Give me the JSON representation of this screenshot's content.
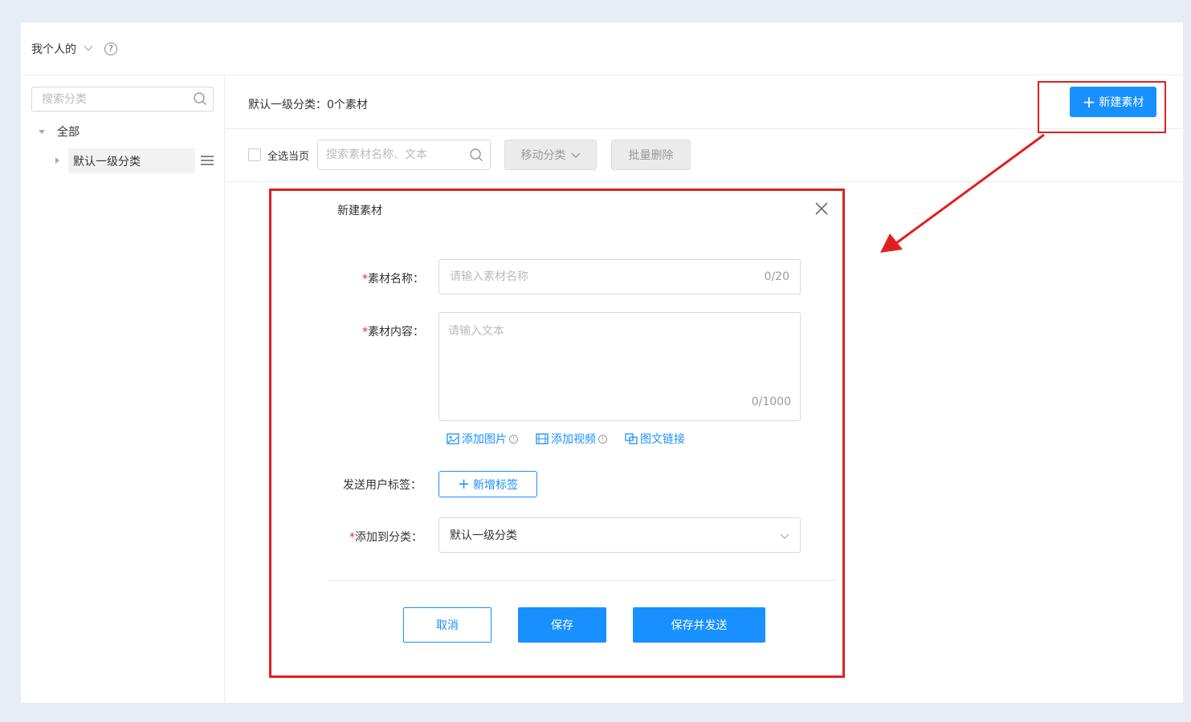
{
  "header": {
    "scope_label": "我个人的",
    "help_icon": "question-circle-icon",
    "help_glyph": "?"
  },
  "sidebar": {
    "search_placeholder": "搜索分类",
    "tree": {
      "root_label": "全部",
      "child_label": "默认一级分类"
    }
  },
  "main": {
    "breadcrumb": "默认一级分类：0个素材",
    "new_button_label": "新建素材",
    "toolbar": {
      "select_page_label": "全选当页",
      "search_placeholder": "搜索素材名称、文本",
      "move_label": "移动分类",
      "batch_delete_label": "批量删除"
    }
  },
  "modal": {
    "title": "新建素材",
    "required_mark": "*",
    "name": {
      "label": "素材名称：",
      "placeholder": "请输入素材名称",
      "counter": "0/20"
    },
    "content": {
      "label": "素材内容：",
      "placeholder": "请输入文本",
      "counter": "0/1000"
    },
    "attachments": {
      "image_label": "添加图片",
      "video_label": "添加视频",
      "link_label": "图文链接",
      "info_glyph": "!"
    },
    "tags": {
      "label": "发送用户标签：",
      "button_label": "新增标签"
    },
    "category": {
      "label": "添加到分类：",
      "value": "默认一级分类"
    },
    "buttons": {
      "cancel": "取消",
      "save": "保存",
      "save_send": "保存并发送"
    }
  },
  "colors": {
    "primary": "#1890ff",
    "highlight": "#e02020",
    "background": "#e8ecf4"
  }
}
